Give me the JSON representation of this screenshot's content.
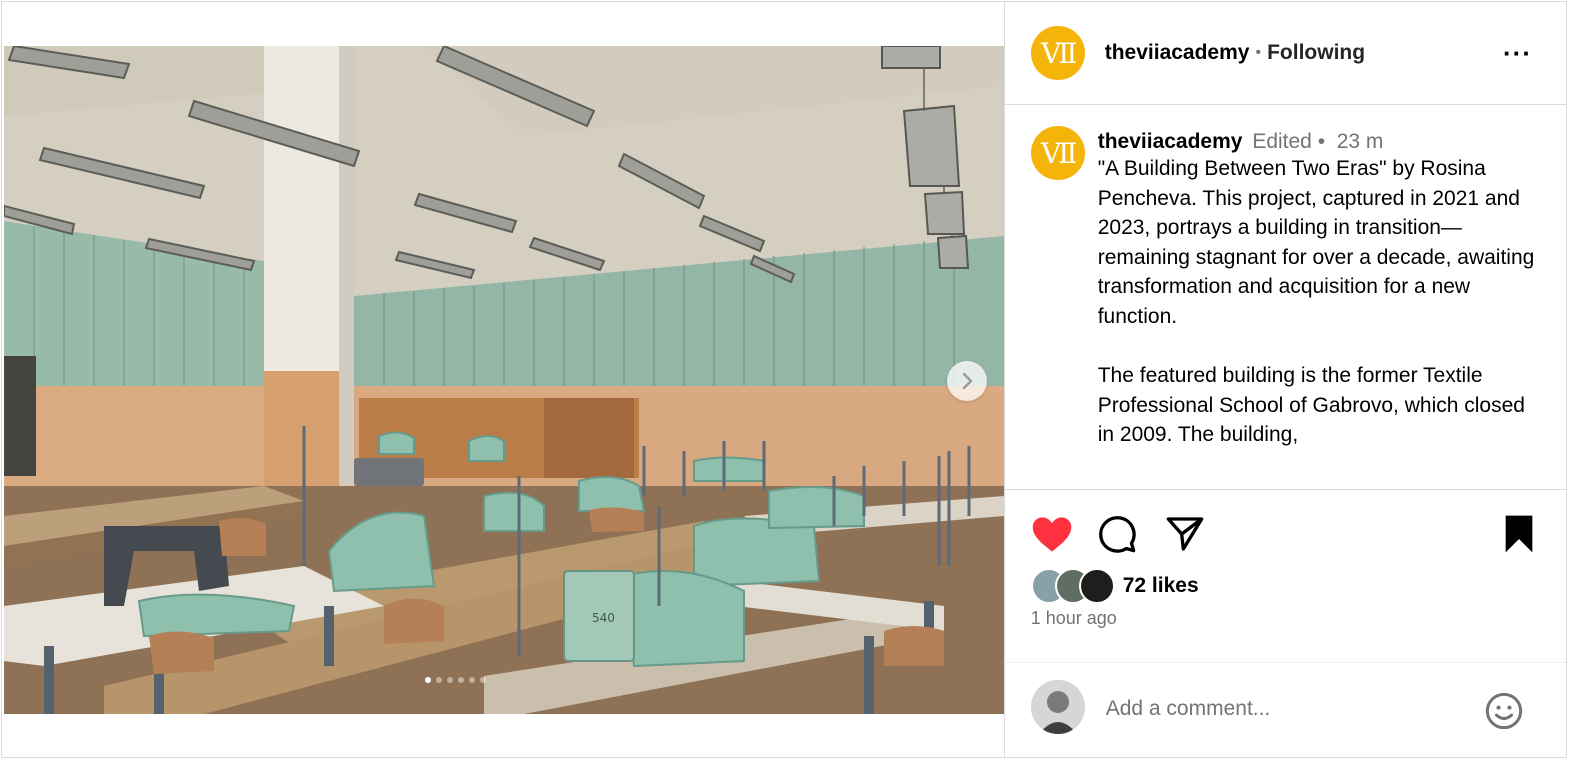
{
  "post": {
    "username": "theviiacademy",
    "follow_status": "Following",
    "logo_text": "VII"
  },
  "caption": {
    "username": "theviiacademy",
    "edited": "Edited",
    "time": "23 m",
    "text": "\"A Building Between Two Eras\" by Rosina Pencheva. This project, captured in 2021 and 2023, portrays a building in transition—remaining stagnant for over a decade, awaiting transformation and acquisition for a new function.\n\nThe featured building is the former Textile Professional School of Gabrovo, which closed in 2009. The building,"
  },
  "photo": {
    "machine_label": "540"
  },
  "actions": {
    "like_icon": "heart-filled-icon",
    "comment_icon": "comment-icon",
    "share_icon": "paper-plane-icon",
    "save_icon": "bookmark-filled-icon"
  },
  "engagement": {
    "likes": "72 likes",
    "posted": "1 hour ago"
  },
  "comment": {
    "placeholder": "Add a comment..."
  },
  "carousel": {
    "slides": 6,
    "active_index": 0
  },
  "colors": {
    "brand_yellow": "#f4b40a",
    "like_red": "#ff3040",
    "muted_text": "#737373",
    "divider": "#dbdbdb"
  }
}
